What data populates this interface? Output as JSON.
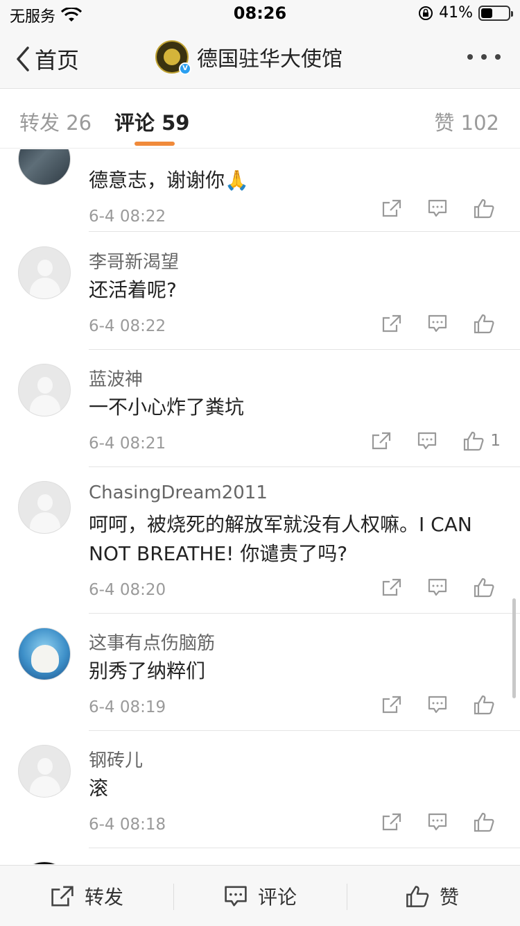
{
  "status_bar": {
    "carrier": "无服务",
    "time": "08:26",
    "battery_percent": "41%",
    "battery_level": 0.41
  },
  "nav": {
    "back_label": "首页",
    "title": "德国驻华大使馆",
    "verified_badge": "V"
  },
  "tabs": [
    {
      "label": "转发 26"
    },
    {
      "label": "评论 59"
    },
    {
      "label": "赞 102"
    }
  ],
  "comments": [
    {
      "name": "",
      "text": "德意志，谢谢你🙏",
      "time": "6-4 08:22",
      "likes": ""
    },
    {
      "name": "李哥新渴望",
      "text": "还活着呢?",
      "time": "6-4 08:22",
      "likes": ""
    },
    {
      "name": "蓝波神",
      "text": "一不小心炸了粪坑",
      "time": "6-4 08:21",
      "likes": "1"
    },
    {
      "name": "ChasingDream2011",
      "text": "呵呵，被烧死的解放军就没有人权嘛。I CAN NOT BREATHE! 你谴责了吗?",
      "time": "6-4 08:20",
      "likes": ""
    },
    {
      "name": "这事有点伤脑筋",
      "text": "别秀了纳粹们",
      "time": "6-4 08:19",
      "likes": ""
    },
    {
      "name": "钢砖儿",
      "text": "滚",
      "time": "6-4 08:18",
      "likes": ""
    }
  ],
  "bottom_bar": {
    "repost_label": "转发",
    "comment_label": "评论",
    "like_label": "赞"
  },
  "colors": {
    "accent": "#f08a3a",
    "verified": "#2a9ff0"
  }
}
